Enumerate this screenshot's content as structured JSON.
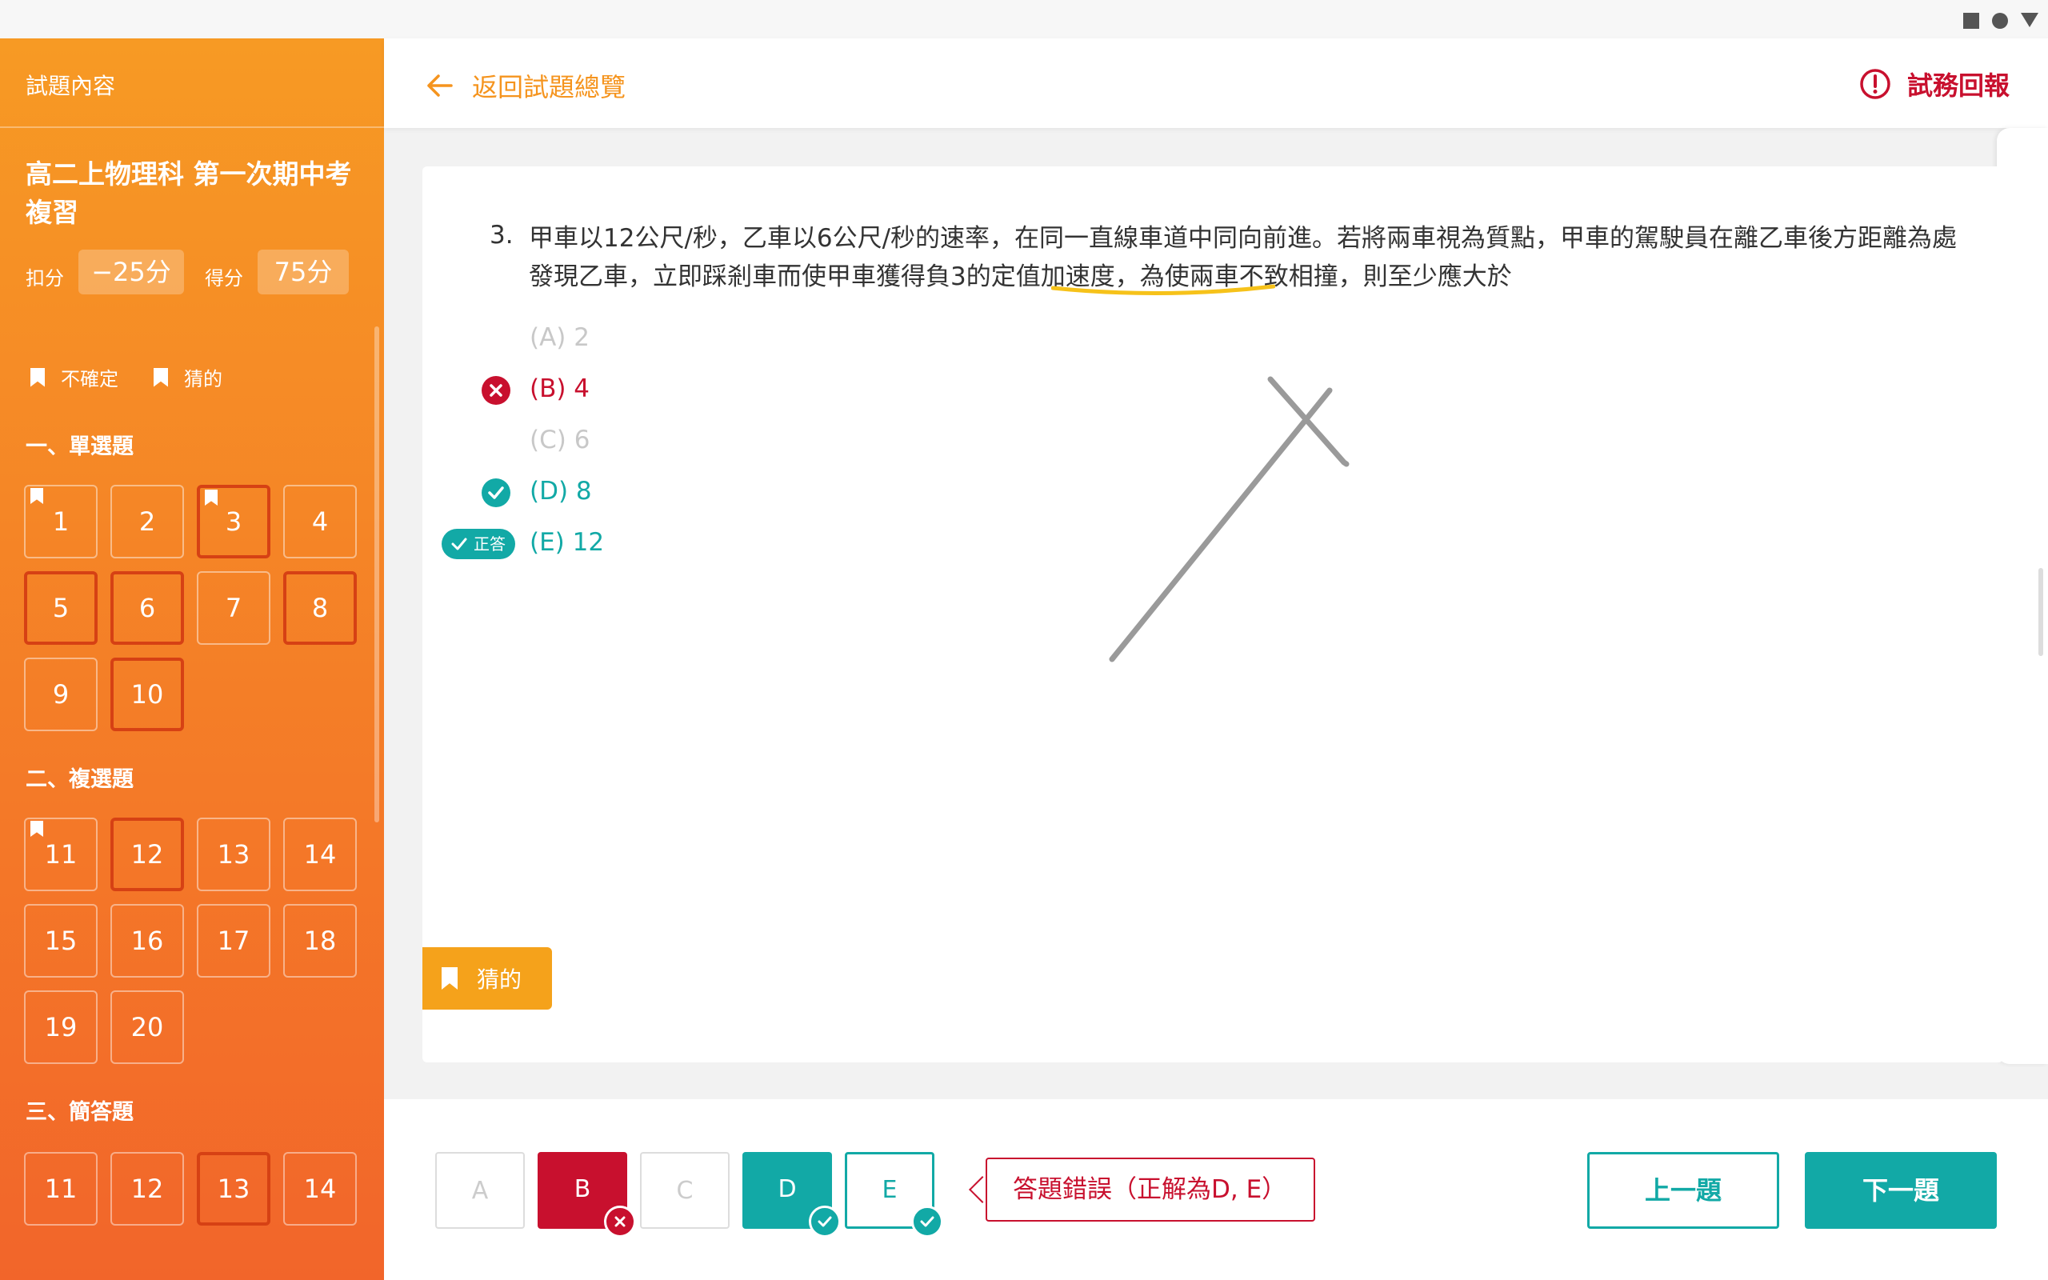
{
  "sidebar": {
    "header": "試題內容",
    "exam_title": "高二上物理科 第一次期中考複習",
    "deduct_label": "扣分",
    "deduct_value": "−25分",
    "score_label": "得分",
    "score_value": "75分",
    "legend_unsure": "不確定",
    "legend_guess": "猜的",
    "sections": [
      {
        "title": "一、單選題",
        "questions": [
          "1",
          "2",
          "3",
          "4",
          "5",
          "6",
          "7",
          "8",
          "9",
          "10"
        ]
      },
      {
        "title": "二、複選題",
        "questions": [
          "11",
          "12",
          "13",
          "14",
          "15",
          "16",
          "17",
          "18",
          "19",
          "20"
        ]
      },
      {
        "title": "三、簡答題",
        "questions": [
          "11",
          "12",
          "13",
          "14"
        ]
      }
    ]
  },
  "header": {
    "back_label": "返回試題總覽",
    "report_label": "試務回報"
  },
  "question": {
    "number": "3.",
    "text": "甲車以12公尺/秒，乙車以6公尺/秒的速率，在同一直線車道中同向前進。若將兩車視為質點，甲車的駕駛員在離乙車後方距離為處發現乙車，立即踩剎車而使甲車獲得負3的定值加速度，為使兩車不致相撞，則至少應大於",
    "options": [
      "(A) 2",
      "(B) 4",
      "(C) 6",
      "(D) 8",
      "(E) 12"
    ],
    "correct_badge": "正答",
    "guess_button": "猜的"
  },
  "answer_bar": {
    "choices": [
      "A",
      "B",
      "C",
      "D",
      "E"
    ],
    "result_text": "答題錯誤（正解為D, E）",
    "prev_label": "上一題",
    "next_label": "下一題"
  },
  "colors": {
    "brand_orange": "#f5941e",
    "wrong_red": "#c8102e",
    "correct_teal": "#12a9a6"
  }
}
